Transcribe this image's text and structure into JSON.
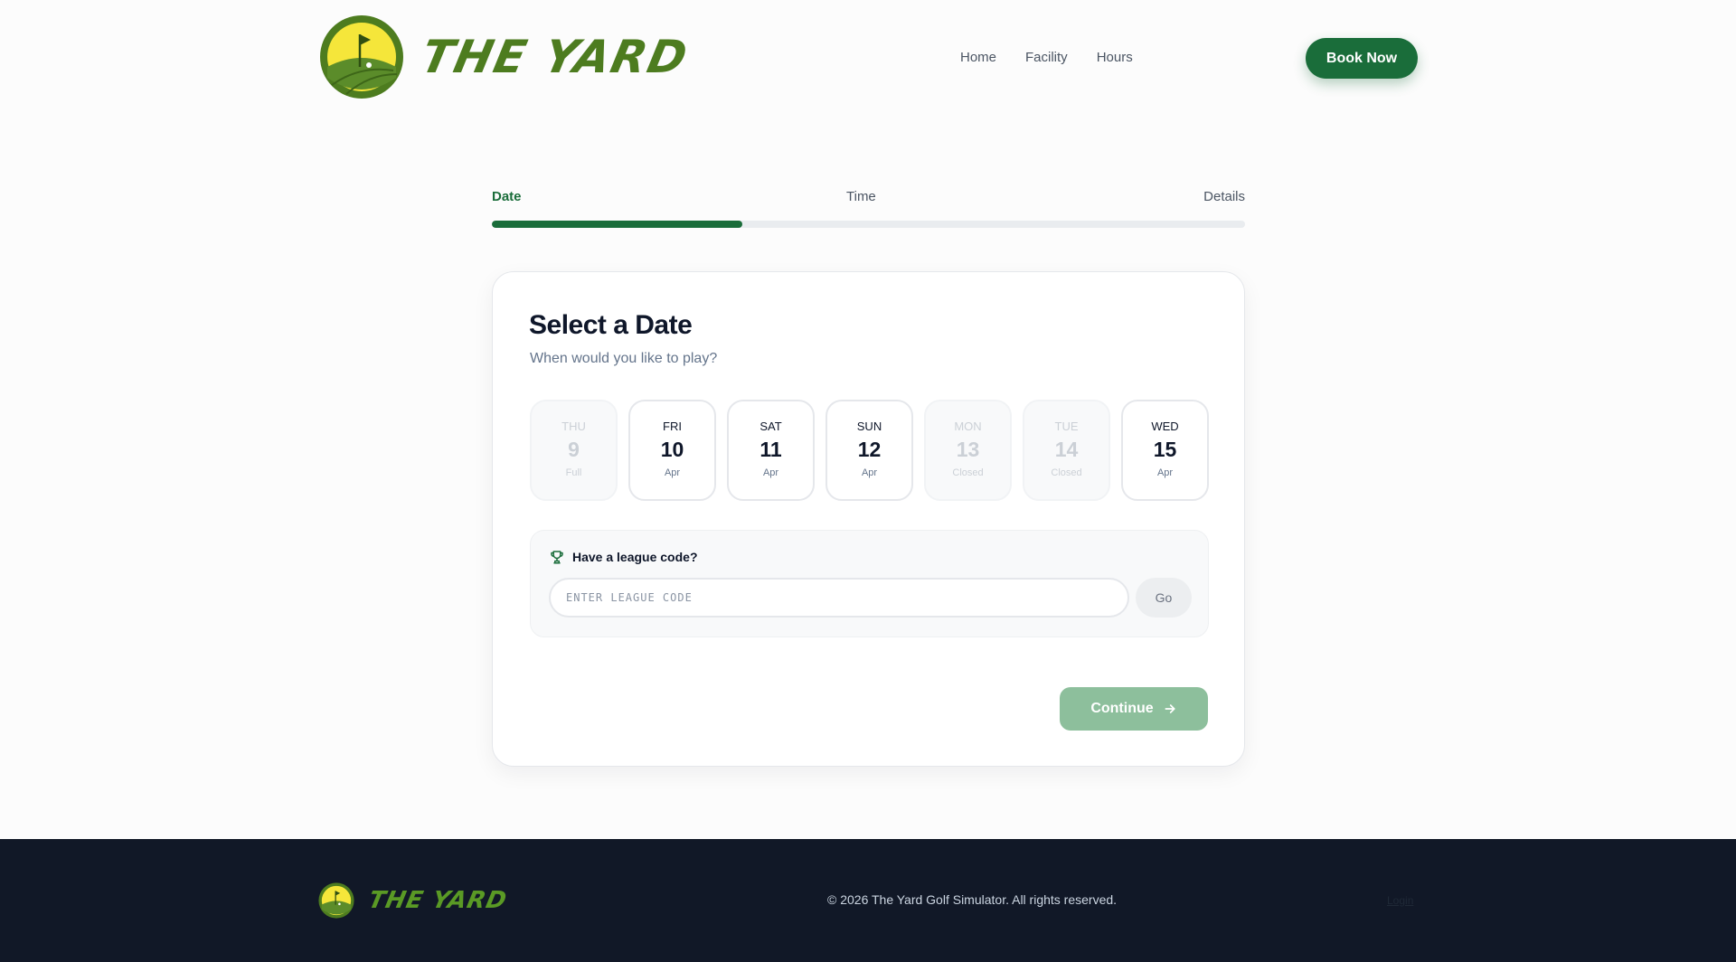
{
  "brand": {
    "name": "THE YARD"
  },
  "nav": {
    "items": [
      "Home",
      "Facility",
      "Hours"
    ],
    "cta": "Book Now"
  },
  "steps": {
    "labels": [
      "Date",
      "Time",
      "Details"
    ],
    "active_index": 0,
    "progress_fraction": 0.333
  },
  "card": {
    "title": "Select a Date",
    "subtitle": "When would you like to play?",
    "days": [
      {
        "dow": "THU",
        "num": "9",
        "sub": "Full",
        "available": false
      },
      {
        "dow": "FRI",
        "num": "10",
        "sub": "Apr",
        "available": true
      },
      {
        "dow": "SAT",
        "num": "11",
        "sub": "Apr",
        "available": true
      },
      {
        "dow": "SUN",
        "num": "12",
        "sub": "Apr",
        "available": true
      },
      {
        "dow": "MON",
        "num": "13",
        "sub": "Closed",
        "available": false
      },
      {
        "dow": "TUE",
        "num": "14",
        "sub": "Closed",
        "available": false
      },
      {
        "dow": "WED",
        "num": "15",
        "sub": "Apr",
        "available": true
      }
    ],
    "league": {
      "heading": "Have a league code?",
      "placeholder": "ENTER LEAGUE CODE",
      "value": "",
      "go_label": "Go"
    },
    "continue_label": "Continue"
  },
  "footer": {
    "copyright": "© 2026 The Yard Golf Simulator. All rights reserved.",
    "login": "Login"
  },
  "colors": {
    "primary": "#1a6d3a",
    "logo_green": "#4d7c1f",
    "logo_yellow": "#f5e63a",
    "footer_bg": "#111827"
  }
}
